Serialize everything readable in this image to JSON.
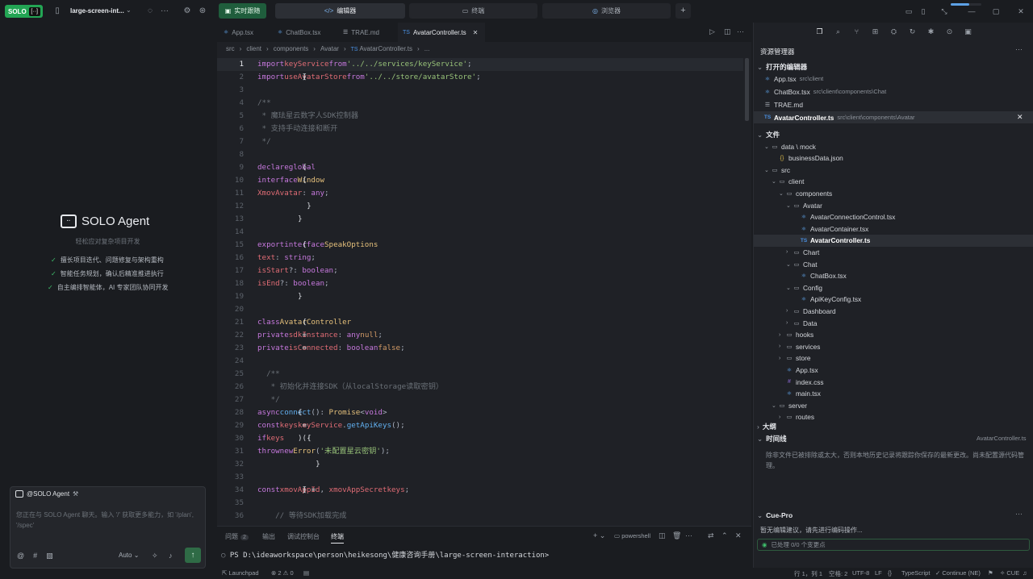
{
  "topbar": {
    "solo_label": "SOLO",
    "solo_icon_label": "[··]",
    "project_name": "large-screen-int...",
    "modes": {
      "realtime": "实时跟随",
      "editor": "编辑器",
      "terminal": "终端",
      "browser": "浏览器"
    },
    "progress_fraction": 0.6
  },
  "sidebar": {
    "agent_title": "SOLO Agent",
    "agent_subtitle": "轻松应对复杂项目开发",
    "features": [
      "擅长项目迭代、问题修复与架构重构",
      "智能任务规划，确认后精准推进执行",
      "自主编排智能体，AI 专家团队协同开发"
    ],
    "chat": {
      "mention": "@SOLO Agent",
      "placeholder": "您正在与 SOLO Agent 聊天。输入 '/' 获取更多能力，如 '/plan', '/spec'",
      "mode": "Auto"
    }
  },
  "editor": {
    "tabs": [
      {
        "icon": "⚛",
        "label": "App.tsx"
      },
      {
        "icon": "⚛",
        "label": "ChatBox.tsx"
      },
      {
        "icon": "☰",
        "label": "TRAE.md"
      },
      {
        "icon": "TS",
        "label": "AvatarController.ts"
      }
    ],
    "breadcrumb": [
      "src",
      "client",
      "components",
      "Avatar",
      "AvatarController.ts",
      "..."
    ],
    "breadcrumb_icon": "TS",
    "code": [
      [
        [
          "kw",
          "import"
        ],
        [
          "tx",
          " "
        ],
        [
          "vr",
          "keyService"
        ],
        [
          "tx",
          " "
        ],
        [
          "kw",
          "from"
        ],
        [
          "tx",
          " "
        ],
        [
          "st",
          "'../../services/keyService'"
        ],
        [
          "pu",
          ";"
        ]
      ],
      [
        [
          "kw",
          "import"
        ],
        [
          "tx",
          " { "
        ],
        [
          "vr",
          "useAvatarStore"
        ],
        [
          "tx",
          " } "
        ],
        [
          "kw",
          "from"
        ],
        [
          "tx",
          " "
        ],
        [
          "st",
          "'../../store/avatarStore'"
        ],
        [
          "pu",
          ";"
        ]
      ],
      [],
      [
        [
          "cm",
          "/**"
        ]
      ],
      [
        [
          "cm",
          " * 魔珐星云数字人SDK控制器"
        ]
      ],
      [
        [
          "cm",
          " * 支持手动连接和断开"
        ]
      ],
      [
        [
          "cm",
          " */"
        ]
      ],
      [],
      [
        [
          "kw",
          "declare"
        ],
        [
          "tx",
          " "
        ],
        [
          "kw",
          "global"
        ],
        [
          "tx",
          " {"
        ]
      ],
      [
        [
          "tx",
          "  "
        ],
        [
          "kw",
          "interface"
        ],
        [
          "tx",
          " "
        ],
        [
          "ty",
          "Window"
        ],
        [
          "tx",
          " {"
        ]
      ],
      [
        [
          "tx",
          "    "
        ],
        [
          "vr",
          "XmovAvatar"
        ],
        [
          "pu",
          ": "
        ],
        [
          "kw",
          "any"
        ],
        [
          "pu",
          ";"
        ]
      ],
      [
        [
          "tx",
          "  }"
        ]
      ],
      [
        [
          "tx",
          "}"
        ]
      ],
      [],
      [
        [
          "kw",
          "export"
        ],
        [
          "tx",
          " "
        ],
        [
          "kw",
          "interface"
        ],
        [
          "tx",
          " "
        ],
        [
          "ty",
          "SpeakOptions"
        ],
        [
          "tx",
          " {"
        ]
      ],
      [
        [
          "tx",
          "  "
        ],
        [
          "vr",
          "text"
        ],
        [
          "pu",
          ": "
        ],
        [
          "kw",
          "string"
        ],
        [
          "pu",
          ";"
        ]
      ],
      [
        [
          "tx",
          "  "
        ],
        [
          "vr",
          "isStart"
        ],
        [
          "pu",
          "?: "
        ],
        [
          "kw",
          "boolean"
        ],
        [
          "pu",
          ";"
        ]
      ],
      [
        [
          "tx",
          "  "
        ],
        [
          "vr",
          "isEnd"
        ],
        [
          "pu",
          "?: "
        ],
        [
          "kw",
          "boolean"
        ],
        [
          "pu",
          ";"
        ]
      ],
      [
        [
          "tx",
          "}"
        ]
      ],
      [],
      [
        [
          "kw",
          "class"
        ],
        [
          "tx",
          " "
        ],
        [
          "ty",
          "AvatarController"
        ],
        [
          "tx",
          " {"
        ]
      ],
      [
        [
          "tx",
          "  "
        ],
        [
          "kw",
          "private"
        ],
        [
          "tx",
          " "
        ],
        [
          "vr",
          "sdkInstance"
        ],
        [
          "pu",
          ": "
        ],
        [
          "kw",
          "any"
        ],
        [
          "tx",
          " = "
        ],
        [
          "nu",
          "null"
        ],
        [
          "pu",
          ";"
        ]
      ],
      [
        [
          "tx",
          "  "
        ],
        [
          "kw",
          "private"
        ],
        [
          "tx",
          " "
        ],
        [
          "vr",
          "isConnected"
        ],
        [
          "pu",
          ": "
        ],
        [
          "kw",
          "boolean"
        ],
        [
          "tx",
          " = "
        ],
        [
          "nu",
          "false"
        ],
        [
          "pu",
          ";"
        ]
      ],
      [],
      [
        [
          "cm",
          "  /**"
        ]
      ],
      [
        [
          "cm",
          "   * 初始化并连接SDK（从localStorage读取密钥）"
        ]
      ],
      [
        [
          "cm",
          "   */"
        ]
      ],
      [
        [
          "tx",
          "  "
        ],
        [
          "kw",
          "async"
        ],
        [
          "tx",
          " "
        ],
        [
          "fn",
          "connect"
        ],
        [
          "pu",
          "(): "
        ],
        [
          "ty",
          "Promise"
        ],
        [
          "pu",
          "<"
        ],
        [
          "kw",
          "void"
        ],
        [
          "pu",
          "> "
        ],
        [
          "tx",
          "{"
        ]
      ],
      [
        [
          "tx",
          "    "
        ],
        [
          "kw",
          "const"
        ],
        [
          "tx",
          " "
        ],
        [
          "vr",
          "keys"
        ],
        [
          "tx",
          " = "
        ],
        [
          "vr",
          "keyService"
        ],
        [
          "pu",
          "."
        ],
        [
          "fn",
          "getApiKeys"
        ],
        [
          "pu",
          "();"
        ]
      ],
      [
        [
          "tx",
          "    "
        ],
        [
          "kw",
          "if"
        ],
        [
          "tx",
          " (!"
        ],
        [
          "vr",
          "keys"
        ],
        [
          "tx",
          ") {"
        ]
      ],
      [
        [
          "tx",
          "      "
        ],
        [
          "kw",
          "throw"
        ],
        [
          "tx",
          " "
        ],
        [
          "kw",
          "new"
        ],
        [
          "tx",
          " "
        ],
        [
          "ty",
          "Error"
        ],
        [
          "pu",
          "("
        ],
        [
          "st",
          "'未配置星云密钥'"
        ],
        [
          "pu",
          ");"
        ]
      ],
      [
        [
          "tx",
          "    }"
        ]
      ],
      [],
      [
        [
          "tx",
          "    "
        ],
        [
          "kw",
          "const"
        ],
        [
          "tx",
          " { "
        ],
        [
          "vr",
          "xmovAppId"
        ],
        [
          "pu",
          ", "
        ],
        [
          "vr",
          "xmovAppSecret"
        ],
        [
          "tx",
          " } = "
        ],
        [
          "vr",
          "keys"
        ],
        [
          "pu",
          ";"
        ]
      ],
      [],
      [
        [
          "cm",
          "    // 等待SDK加载完成"
        ]
      ]
    ],
    "panel": {
      "tabs": {
        "problems": "问题",
        "problems_count": "2",
        "output": "输出",
        "debug": "调试控制台",
        "terminal": "终端"
      },
      "shell": "powershell",
      "terminal_line": "PS D:\\ideaworkspace\\person\\heikesong\\健康咨询手册\\large-screen-interaction>"
    }
  },
  "explorer": {
    "title": "资源管理器",
    "open_editors_title": "打开的编辑器",
    "open_editors": [
      {
        "icon": "⚛",
        "name": "App.tsx",
        "path": "src\\client"
      },
      {
        "icon": "⚛",
        "name": "ChatBox.tsx",
        "path": "src\\client\\components\\Chat"
      },
      {
        "icon": "☰",
        "name": "TRAE.md",
        "path": ""
      },
      {
        "icon": "TS",
        "name": "AvatarController.ts",
        "path": "src\\client\\components\\Avatar"
      }
    ],
    "files_title": "文件",
    "tree": [
      {
        "name": "data \\ mock",
        "icon": "🗀",
        "chev": "⌄"
      },
      {
        "name": "businessData.json",
        "icon": "{}",
        "chev": ""
      },
      {
        "name": "src",
        "icon": "🗀",
        "chev": "⌄"
      },
      {
        "name": "client",
        "icon": "🗀",
        "chev": "⌄"
      },
      {
        "name": "components",
        "icon": "🗀",
        "chev": "⌄"
      },
      {
        "name": "Avatar",
        "icon": "🗀",
        "chev": "⌄"
      },
      {
        "name": "AvatarConnectionControl.tsx",
        "icon": "⚛",
        "chev": ""
      },
      {
        "name": "AvatarContainer.tsx",
        "icon": "⚛",
        "chev": ""
      },
      {
        "name": "AvatarController.ts",
        "icon": "TS",
        "chev": ""
      },
      {
        "name": "Chart",
        "icon": "🗀",
        "chev": "›"
      },
      {
        "name": "Chat",
        "icon": "🗀",
        "chev": "⌄"
      },
      {
        "name": "ChatBox.tsx",
        "icon": "⚛",
        "chev": ""
      },
      {
        "name": "Config",
        "icon": "🗀",
        "chev": "⌄"
      },
      {
        "name": "ApiKeyConfig.tsx",
        "icon": "⚛",
        "chev": ""
      },
      {
        "name": "Dashboard",
        "icon": "🗀",
        "chev": "›"
      },
      {
        "name": "Data",
        "icon": "🗀",
        "chev": "›"
      },
      {
        "name": "hooks",
        "icon": "🗀",
        "chev": "›"
      },
      {
        "name": "services",
        "icon": "🗀",
        "chev": "›"
      },
      {
        "name": "store",
        "icon": "🗀",
        "chev": "›"
      },
      {
        "name": "App.tsx",
        "icon": "⚛",
        "chev": ""
      },
      {
        "name": "index.css",
        "icon": "#",
        "chev": ""
      },
      {
        "name": "main.tsx",
        "icon": "⚛",
        "chev": ""
      },
      {
        "name": "server",
        "icon": "🗀",
        "chev": "⌄"
      },
      {
        "name": "routes",
        "icon": "🗀",
        "chev": "›"
      }
    ],
    "outline_title": "大纲",
    "timeline_title": "时间线",
    "timeline_file": "AvatarController.ts",
    "timeline_msg": "除非文件已被排除或太大，否则本地历史记录将跟踪你保存的最新更改。尚未配置源代码管理。",
    "cue_title": "Cue-Pro",
    "cue_msg": "暂无编辑建议，请先进行编码操作...",
    "cue_status": "已处理 0/0 个变更点"
  },
  "status": {
    "launchpad": "Launchpad",
    "errors": "2",
    "warnings": "0",
    "position": "行 1，列 1",
    "spaces": "空格: 2",
    "encoding": "UTF-8",
    "eol": "LF",
    "language": "TypeScript",
    "continue": "Continue (NE)",
    "cue": "CUE"
  }
}
